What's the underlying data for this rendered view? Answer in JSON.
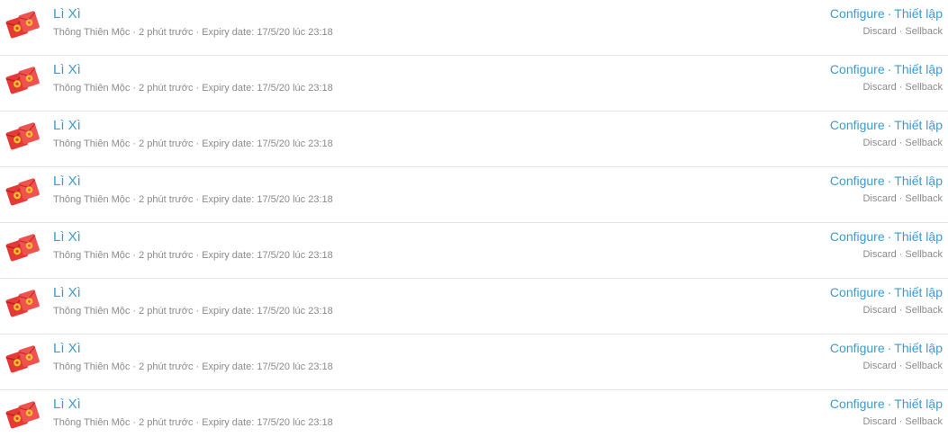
{
  "items": [
    {
      "title": "Lì Xì",
      "owner": "Thông Thiên Mộc",
      "time": "2 phút trước",
      "expiry": "Expiry date: 17/5/20 lúc 23:18",
      "configure": "Configure",
      "setup": "Thiết lập",
      "discard": "Discard",
      "sellback": "Sellback",
      "icon": "red-envelope-icon"
    },
    {
      "title": "Lì Xì",
      "owner": "Thông Thiên Mộc",
      "time": "2 phút trước",
      "expiry": "Expiry date: 17/5/20 lúc 23:18",
      "configure": "Configure",
      "setup": "Thiết lập",
      "discard": "Discard",
      "sellback": "Sellback",
      "icon": "red-envelope-icon"
    },
    {
      "title": "Lì Xì",
      "owner": "Thông Thiên Mộc",
      "time": "2 phút trước",
      "expiry": "Expiry date: 17/5/20 lúc 23:18",
      "configure": "Configure",
      "setup": "Thiết lập",
      "discard": "Discard",
      "sellback": "Sellback",
      "icon": "red-envelope-icon"
    },
    {
      "title": "Lì Xì",
      "owner": "Thông Thiên Mộc",
      "time": "2 phút trước",
      "expiry": "Expiry date: 17/5/20 lúc 23:18",
      "configure": "Configure",
      "setup": "Thiết lập",
      "discard": "Discard",
      "sellback": "Sellback",
      "icon": "red-envelope-icon"
    },
    {
      "title": "Lì Xì",
      "owner": "Thông Thiên Mộc",
      "time": "2 phút trước",
      "expiry": "Expiry date: 17/5/20 lúc 23:18",
      "configure": "Configure",
      "setup": "Thiết lập",
      "discard": "Discard",
      "sellback": "Sellback",
      "icon": "red-envelope-icon"
    },
    {
      "title": "Lì Xì",
      "owner": "Thông Thiên Mộc",
      "time": "2 phút trước",
      "expiry": "Expiry date: 17/5/20 lúc 23:18",
      "configure": "Configure",
      "setup": "Thiết lập",
      "discard": "Discard",
      "sellback": "Sellback",
      "icon": "red-envelope-icon"
    },
    {
      "title": "Lì Xì",
      "owner": "Thông Thiên Mộc",
      "time": "2 phút trước",
      "expiry": "Expiry date: 17/5/20 lúc 23:18",
      "configure": "Configure",
      "setup": "Thiết lập",
      "discard": "Discard",
      "sellback": "Sellback",
      "icon": "red-envelope-icon"
    },
    {
      "title": "Lì Xì",
      "owner": "Thông Thiên Mộc",
      "time": "2 phút trước",
      "expiry": "Expiry date: 17/5/20 lúc 23:18",
      "configure": "Configure",
      "setup": "Thiết lập",
      "discard": "Discard",
      "sellback": "Sellback",
      "icon": "red-envelope-icon"
    }
  ],
  "separator": "·",
  "colors": {
    "link": "#3a9bd2",
    "muted": "#8a8a8a",
    "envelope": "#e53935",
    "coin": "#fbc02d"
  }
}
